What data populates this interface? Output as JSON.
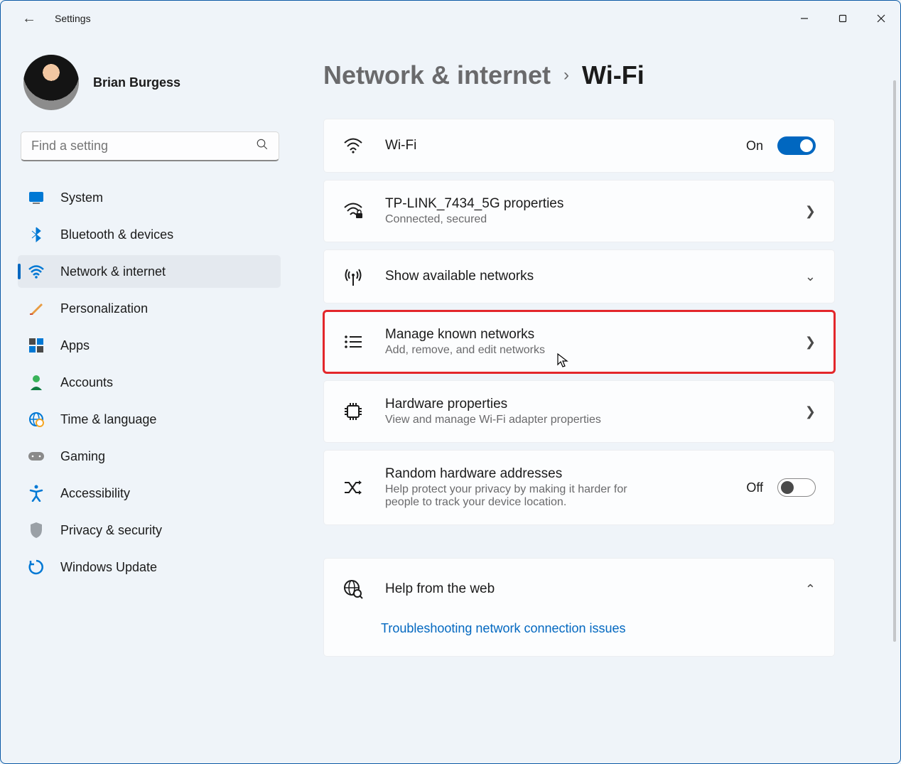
{
  "titlebar": {
    "app_title": "Settings"
  },
  "user": {
    "name": "Brian Burgess"
  },
  "search": {
    "placeholder": "Find a setting"
  },
  "sidebar": {
    "items": [
      {
        "label": "System"
      },
      {
        "label": "Bluetooth & devices"
      },
      {
        "label": "Network & internet"
      },
      {
        "label": "Personalization"
      },
      {
        "label": "Apps"
      },
      {
        "label": "Accounts"
      },
      {
        "label": "Time & language"
      },
      {
        "label": "Gaming"
      },
      {
        "label": "Accessibility"
      },
      {
        "label": "Privacy & security"
      },
      {
        "label": "Windows Update"
      }
    ]
  },
  "breadcrumb": {
    "parent": "Network & internet",
    "current": "Wi-Fi"
  },
  "cards": {
    "wifi": {
      "title": "Wi-Fi",
      "state": "On"
    },
    "props": {
      "title": "TP-LINK_7434_5G properties",
      "sub": "Connected, secured"
    },
    "available": {
      "title": "Show available networks"
    },
    "known": {
      "title": "Manage known networks",
      "sub": "Add, remove, and edit networks"
    },
    "hardware": {
      "title": "Hardware properties",
      "sub": "View and manage Wi-Fi adapter properties"
    },
    "random": {
      "title": "Random hardware addresses",
      "sub": "Help protect your privacy by making it harder for people to track your device location.",
      "state": "Off"
    },
    "help": {
      "title": "Help from the web",
      "link": "Troubleshooting network connection issues"
    }
  }
}
